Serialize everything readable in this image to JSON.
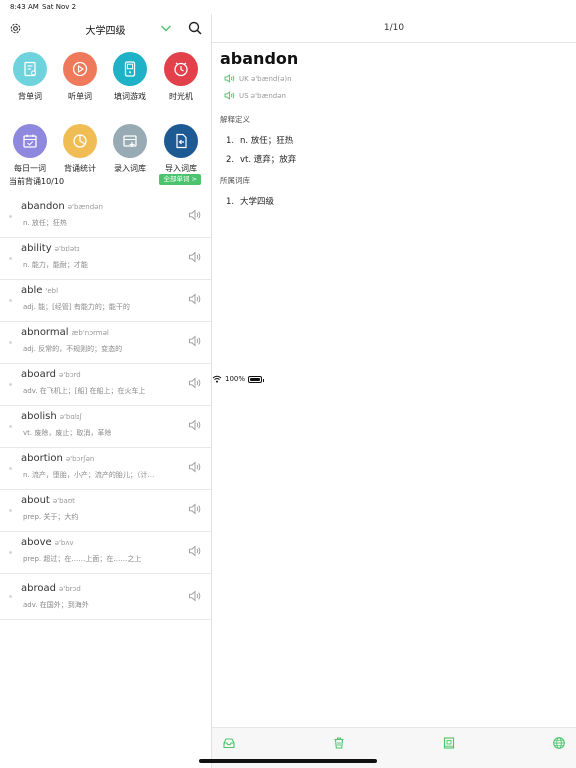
{
  "status": {
    "time": "8:43 AM",
    "date": "Sat Nov 2",
    "battery": "100%"
  },
  "left": {
    "title": "大学四级",
    "grid": [
      {
        "label": "背单词",
        "color": "#6ed3dc",
        "icon": "card-icon"
      },
      {
        "label": "听单词",
        "color": "#ee7a5b",
        "icon": "play-icon"
      },
      {
        "label": "填词游戏",
        "color": "#1fb1c6",
        "icon": "gameboy-icon"
      },
      {
        "label": "时光机",
        "color": "#e2404b",
        "icon": "clock-icon"
      },
      {
        "label": "每日一词",
        "color": "#8f88df",
        "icon": "calendar-icon"
      },
      {
        "label": "背诵统计",
        "color": "#f0bd55",
        "icon": "pie-icon"
      },
      {
        "label": "录入词库",
        "color": "#98aab3",
        "icon": "add-card-icon"
      },
      {
        "label": "导入词库",
        "color": "#1d5a93",
        "icon": "import-icon"
      }
    ],
    "progress_text": "当前背诵10/10",
    "all_words_label": "全部单词 >",
    "words": [
      {
        "word": "abandon",
        "phonetic": "ə'bændən",
        "def": "n. 放任；狂热"
      },
      {
        "word": "ability",
        "phonetic": "ə'bɪlətɪ",
        "def": "n. 能力，能耐；才能"
      },
      {
        "word": "able",
        "phonetic": "'ebl",
        "def": "adj. 能；[经管] 有能力的；能干的"
      },
      {
        "word": "abnormal",
        "phonetic": "æb'nɔrməl",
        "def": "adj. 反常的，不规则的；变态的"
      },
      {
        "word": "aboard",
        "phonetic": "ə'bɔrd",
        "def": "adv. 在飞机上；[船] 在船上；在火车上"
      },
      {
        "word": "abolish",
        "phonetic": "ə'bɑlɪʃ",
        "def": "vt. 废除，废止；取消，革除"
      },
      {
        "word": "abortion",
        "phonetic": "ə'bɔrʃən",
        "def": "n. 流产，堕胎，小产；流产的胎儿；（计…"
      },
      {
        "word": "about",
        "phonetic": "ə'baʊt",
        "def": "prep. 关于；大约"
      },
      {
        "word": "above",
        "phonetic": "ə'bʌv",
        "def": "prep. 超过；在……上面；在……之上"
      },
      {
        "word": "abroad",
        "phonetic": "ə'brɔd",
        "def": "adv. 在国外；到海外"
      }
    ]
  },
  "right": {
    "page": "1/10",
    "headword": "abandon",
    "uk": "UK ə'bænd(ə)n",
    "us": "US ə'bændən",
    "def_title": "解释定义",
    "defs": [
      {
        "num": "1.",
        "text": "n. 放任；狂热"
      },
      {
        "num": "2.",
        "text": "vt. 遗弃；放弃"
      }
    ],
    "lib_title": "所属词库",
    "libs": [
      {
        "num": "1.",
        "text": "大学四级"
      }
    ]
  },
  "colors": {
    "accent": "#4cc46e"
  }
}
